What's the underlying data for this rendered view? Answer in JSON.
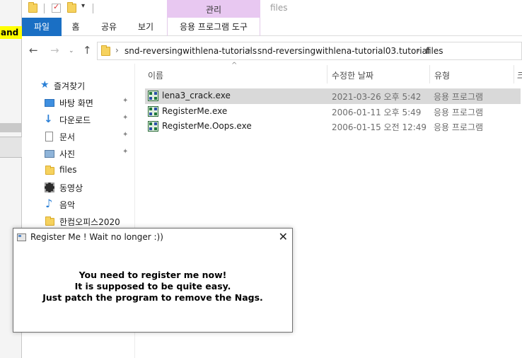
{
  "background_app": {
    "text": "and"
  },
  "titlebar": {
    "manage_label": "관리",
    "window_title": "files",
    "dropdown_glyph": "▾"
  },
  "ribbon": {
    "tabs": [
      {
        "label": "파일"
      },
      {
        "label": "홈"
      },
      {
        "label": "공유"
      },
      {
        "label": "보기"
      },
      {
        "label": "응용 프로그램 도구"
      }
    ]
  },
  "nav": {
    "back": "←",
    "forward": "→",
    "recent": "⌄",
    "up": "↑"
  },
  "address": {
    "separator": "›",
    "crumbs": [
      "snd-reversingwithlena-tutorials",
      "snd-reversingwithlena-tutorial03.tutorial",
      "files"
    ]
  },
  "sidebar": {
    "pin_glyph": "✦",
    "items": [
      {
        "label": "즐겨찾기",
        "icon": "star-icon"
      },
      {
        "label": "바탕 화면",
        "icon": "desktop-icon",
        "pinned": true
      },
      {
        "label": "다운로드",
        "icon": "download-icon",
        "pinned": true
      },
      {
        "label": "문서",
        "icon": "document-icon",
        "pinned": true
      },
      {
        "label": "사진",
        "icon": "pictures-icon",
        "pinned": true
      },
      {
        "label": "files",
        "icon": "folder-icon"
      },
      {
        "label": "동영상",
        "icon": "video-icon"
      },
      {
        "label": "음악",
        "icon": "music-icon"
      },
      {
        "label": "한컴오피스2020",
        "icon": "folder-icon"
      }
    ]
  },
  "file_list": {
    "sort_indicator": "^",
    "columns": [
      "이름",
      "수정한 날짜",
      "유형",
      "크"
    ],
    "rows": [
      {
        "name": "lena3_crack.exe",
        "modified": "2021-03-26 오후 5:42",
        "type": "응용 프로그램",
        "selected": true
      },
      {
        "name": "RegisterMe.exe",
        "modified": "2006-01-11 오후 5:49",
        "type": "응용 프로그램",
        "selected": false
      },
      {
        "name": "RegisterMe.Oops.exe",
        "modified": "2006-01-15 오전 12:49",
        "type": "응용 프로그램",
        "selected": false
      }
    ]
  },
  "dialog": {
    "title": "Register Me ! Wait no longer :))",
    "close_glyph": "✕",
    "message_lines": [
      "You need to register me now!",
      "It is supposed to be quite easy.",
      "Just patch the program to remove the Nags."
    ]
  },
  "colors": {
    "file_tab_bg": "#1a6fc4",
    "manage_context_bg": "#e8c8f1",
    "selected_row_bg": "#d9d9d9",
    "highlight_yellow": "#ffff00"
  }
}
